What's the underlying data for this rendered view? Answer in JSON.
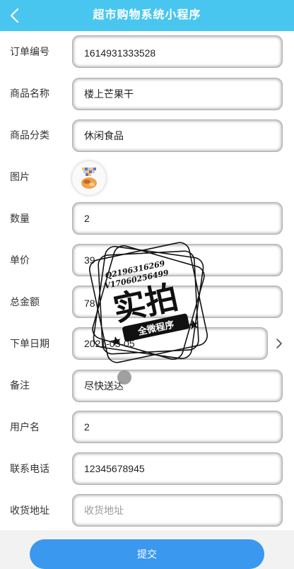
{
  "header": {
    "title": "超市购物系统小程序"
  },
  "form": {
    "rows": [
      {
        "label": "订单编号",
        "value": "1614931333528",
        "placeholder": ""
      },
      {
        "label": "商品名称",
        "value": "楼上芒果干",
        "placeholder": ""
      },
      {
        "label": "商品分类",
        "value": "休闲食品",
        "placeholder": ""
      },
      {
        "label": "图片"
      },
      {
        "label": "数量",
        "value": "2",
        "placeholder": ""
      },
      {
        "label": "单价",
        "value": "39",
        "placeholder": ""
      },
      {
        "label": "总金额",
        "value": "78",
        "placeholder": ""
      },
      {
        "label": "下单日期",
        "value": "2021-03-05",
        "placeholder": ""
      },
      {
        "label": "备注",
        "value": "尽快送达",
        "placeholder": ""
      },
      {
        "label": "用户名",
        "value": "2",
        "placeholder": ""
      },
      {
        "label": "联系电话",
        "value": "12345678945",
        "placeholder": ""
      },
      {
        "label": "收货地址",
        "value": "",
        "placeholder": "收货地址"
      }
    ]
  },
  "footer": {
    "submit_label": "提交"
  },
  "watermark": {
    "qq": "Q2196316269",
    "vx": "V17060256499",
    "main": "实拍",
    "sub": "全微程序"
  },
  "icons": {
    "back": "chevron-left-icon",
    "date_picker": "chevron-right-icon"
  },
  "colors": {
    "header_bg": "#49c6ef",
    "submit_bg": "#3a98ef",
    "page_bg": "#f2f2f2"
  }
}
